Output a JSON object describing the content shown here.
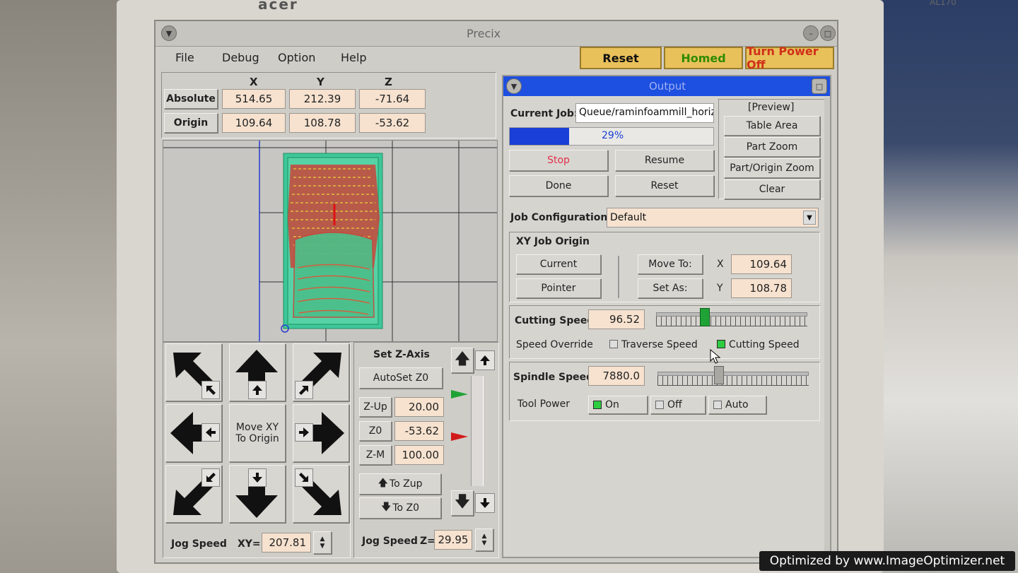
{
  "bezel": {
    "logo": "acer",
    "model": "AL170"
  },
  "window": {
    "title": "Precix"
  },
  "menu": [
    "File",
    "Debug",
    "Option",
    "Help"
  ],
  "top_buttons": {
    "reset": "Reset",
    "homed": "Homed",
    "power_off": "Turn Power Off"
  },
  "dro": {
    "headers": [
      "X",
      "Y",
      "Z"
    ],
    "absolute_label": "Absolute",
    "origin_label": "Origin",
    "absolute": [
      "514.65",
      "212.39",
      "-71.64"
    ],
    "origin": [
      "109.64",
      "108.78",
      "-53.62"
    ]
  },
  "jog": {
    "center_label_1": "Move XY",
    "center_label_2": "To Origin",
    "speed_label": "Jog Speed",
    "xy_prefix": "XY=",
    "xy_value": "207.81"
  },
  "z_axis": {
    "title": "Set Z-Axis",
    "autoset": "AutoSet Z0",
    "zup_label": "Z-Up",
    "zup_value": "20.00",
    "z0_label": "Z0",
    "z0_value": "-53.62",
    "zm_label": "Z-M",
    "zm_value": "100.00",
    "to_zup": "To Zup",
    "to_z0": "To Z0",
    "speed_label": "Jog Speed",
    "z_prefix": "Z=",
    "z_value": "29.95"
  },
  "output": {
    "title": "Output",
    "current_job_label": "Current Job:",
    "current_job_value": "Queue/raminfoammill_horizo",
    "progress_percent": 29,
    "progress_text": "29%",
    "stop": "Stop",
    "resume": "Resume",
    "done": "Done",
    "reset": "Reset",
    "preview_label": "[Preview]",
    "table_area": "Table Area",
    "part_zoom": "Part Zoom",
    "part_origin_zoom": "Part/Origin Zoom",
    "clear": "Clear",
    "job_config_label": "Job Configuration",
    "job_config_value": "Default",
    "xy_origin_title": "XY Job Origin",
    "current_btn": "Current",
    "pointer_btn": "Pointer",
    "move_to": "Move To:",
    "set_as": "Set As:",
    "x_label": "X",
    "y_label": "Y",
    "x_value": "109.64",
    "y_value": "108.78",
    "cutting_speed_label": "Cutting Speed",
    "cutting_speed_value": "96.52",
    "speed_override_label": "Speed Override",
    "traverse_speed": "Traverse Speed",
    "cutting_speed_cb": "Cutting Speed",
    "spindle_speed_label": "Spindle Speed",
    "spindle_speed_value": "7880.0",
    "tool_power_label": "Tool Power",
    "on": "On",
    "off": "Off",
    "auto": "Auto"
  },
  "watermark": "Optimized by www.ImageOptimizer.net",
  "colors": {
    "progress": "#1a3fd6",
    "output_title": "#1d4fe0",
    "stop_text": "#e0304a",
    "reset_bg": "#e8c15a",
    "homed_text": "#2e8b00",
    "power_text": "#d0301a"
  }
}
